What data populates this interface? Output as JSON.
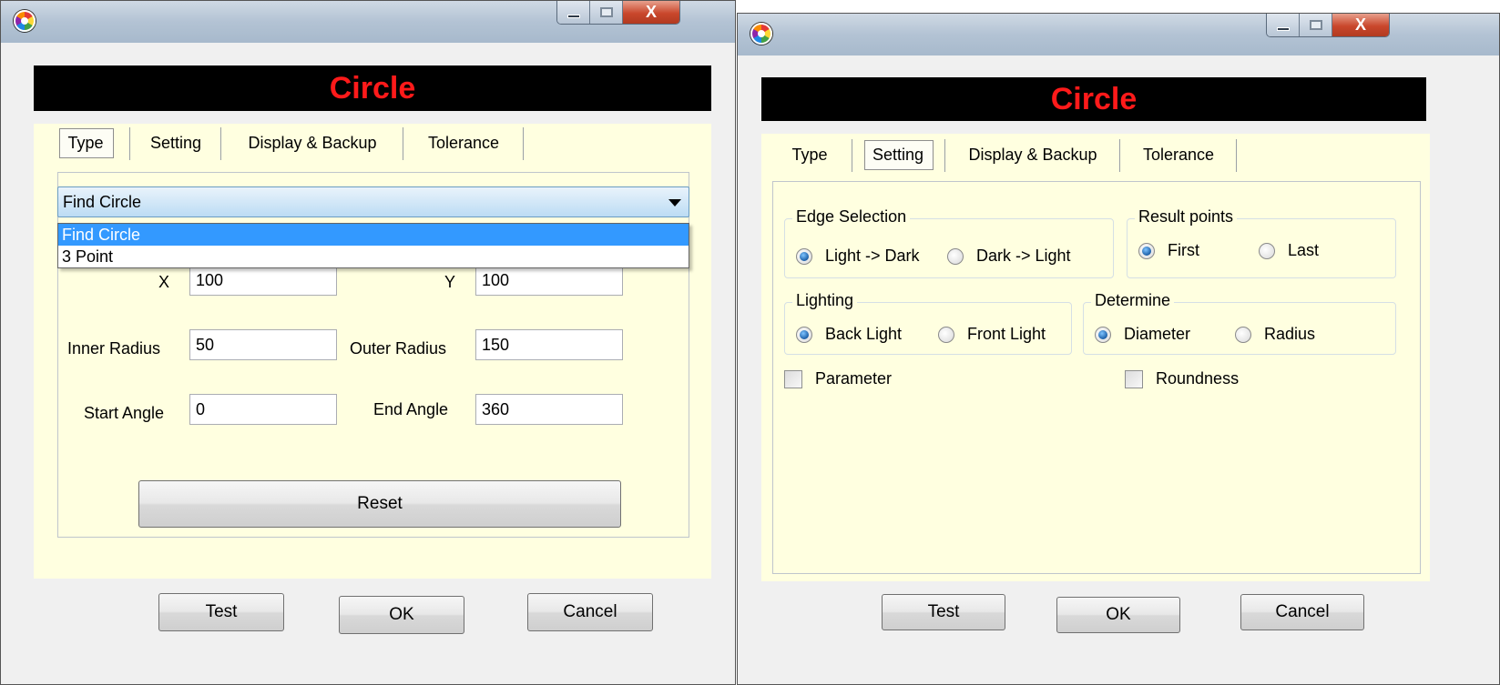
{
  "left_window": {
    "banner_title": "Circle",
    "tabs": [
      {
        "label": "Type",
        "selected": true
      },
      {
        "label": "Setting",
        "selected": false
      },
      {
        "label": "Display & Backup",
        "selected": false
      },
      {
        "label": "Tolerance",
        "selected": false
      }
    ],
    "combo": {
      "selected": "Find Circle",
      "options": [
        "Find Circle",
        "3 Point"
      ],
      "highlighted_index": 0
    },
    "fields": {
      "x": {
        "label": "X",
        "value": "100"
      },
      "y": {
        "label": "Y",
        "value": "100"
      },
      "inner_radius": {
        "label": "Inner Radius",
        "value": "50"
      },
      "outer_radius": {
        "label": "Outer Radius",
        "value": "150"
      },
      "start_angle": {
        "label": "Start Angle",
        "value": "0"
      },
      "end_angle": {
        "label": "End Angle",
        "value": "360"
      }
    },
    "reset_label": "Reset",
    "buttons": {
      "test": "Test",
      "ok": "OK",
      "cancel": "Cancel"
    }
  },
  "right_window": {
    "banner_title": "Circle",
    "tabs": [
      {
        "label": "Type",
        "selected": false
      },
      {
        "label": "Setting",
        "selected": true
      },
      {
        "label": "Display & Backup",
        "selected": false
      },
      {
        "label": "Tolerance",
        "selected": false
      }
    ],
    "edge_selection": {
      "title": "Edge Selection",
      "options": [
        {
          "label": "Light -> Dark",
          "checked": true
        },
        {
          "label": "Dark -> Light",
          "checked": false
        }
      ]
    },
    "result_points": {
      "title": "Result points",
      "options": [
        {
          "label": "First",
          "checked": true
        },
        {
          "label": "Last",
          "checked": false
        }
      ]
    },
    "lighting": {
      "title": "Lighting",
      "options": [
        {
          "label": "Back Light",
          "checked": true
        },
        {
          "label": "Front Light",
          "checked": false
        }
      ]
    },
    "determine": {
      "title": "Determine",
      "options": [
        {
          "label": "Diameter",
          "checked": true
        },
        {
          "label": "Radius",
          "checked": false
        }
      ]
    },
    "checkboxes": {
      "parameter": {
        "label": "Parameter",
        "checked": false
      },
      "roundness": {
        "label": "Roundness",
        "checked": false
      }
    },
    "buttons": {
      "test": "Test",
      "ok": "OK",
      "cancel": "Cancel"
    }
  },
  "titlebar_controls": {
    "close_glyph": "X"
  },
  "colors": {
    "banner_bg": "#000000",
    "banner_text": "#ff1a1a",
    "panel_bg": "#ffffe0",
    "dropdown_highlight": "#3399ff"
  }
}
